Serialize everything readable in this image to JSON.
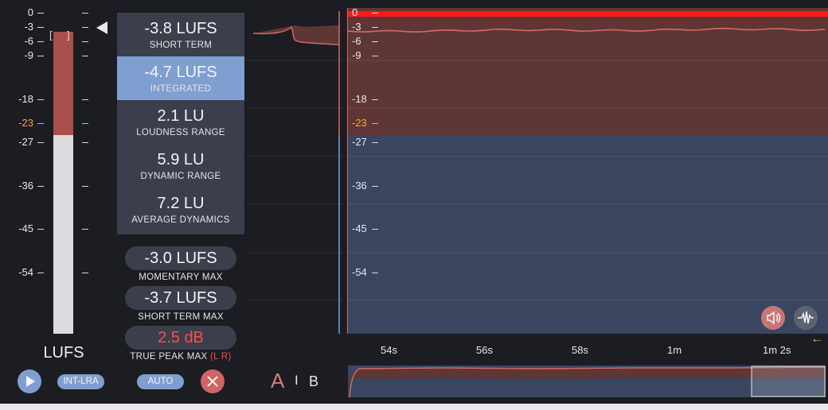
{
  "meter": {
    "scale_labels": [
      "0",
      "-3",
      "-6",
      "-9",
      "-18",
      "-23",
      "-27",
      "-36",
      "-45",
      "-54"
    ],
    "target_label": "-23",
    "unit": "LUFS",
    "fill_top_db": -3,
    "fill_bottom_db": -23,
    "colors": {
      "fill": "#a9504a",
      "empty": "#dcdcde",
      "accent": "#f2a93b"
    }
  },
  "stats": [
    {
      "value": "-3.8 LUFS",
      "label": "SHORT TERM"
    },
    {
      "value": "-4.7 LUFS",
      "label": "INTEGRATED"
    },
    {
      "value": "2.1 LU",
      "label": "LOUDNESS RANGE"
    },
    {
      "value": "5.9 LU",
      "label": "DYNAMIC RANGE"
    },
    {
      "value": "7.2 LU",
      "label": "AVERAGE DYNAMICS"
    }
  ],
  "max": {
    "momentary": {
      "value": "-3.0 LUFS",
      "label": "MOMENTARY MAX"
    },
    "short_term": {
      "value": "-3.7 LUFS",
      "label": "SHORT TERM MAX"
    },
    "true_peak": {
      "value": "2.5 dB",
      "label": "TRUE PEAK MAX",
      "channels": "(L R)"
    }
  },
  "graph": {
    "scale_labels": [
      "0",
      "-3",
      "-6",
      "-9",
      "-18",
      "-23",
      "-27",
      "-36",
      "-45",
      "-54"
    ],
    "time_labels": [
      "54s",
      "56s",
      "58s",
      "1m",
      "1m 2s"
    ],
    "loudness_level_db": -3.8,
    "colors": {
      "above_target": "#5e3636",
      "below_target": "#3a4660",
      "line": "#d46b62",
      "ceiling": "#ff1a1a"
    }
  },
  "controls": {
    "play": "play-icon",
    "int_lra": "INT-LRA",
    "auto": "AUTO",
    "reset": "close-icon",
    "ab_a": "A",
    "ab_sep": "I",
    "ab_b": "B",
    "speaker": "speaker-icon",
    "waveform": "waveform-icon",
    "back_arrow": "←"
  }
}
